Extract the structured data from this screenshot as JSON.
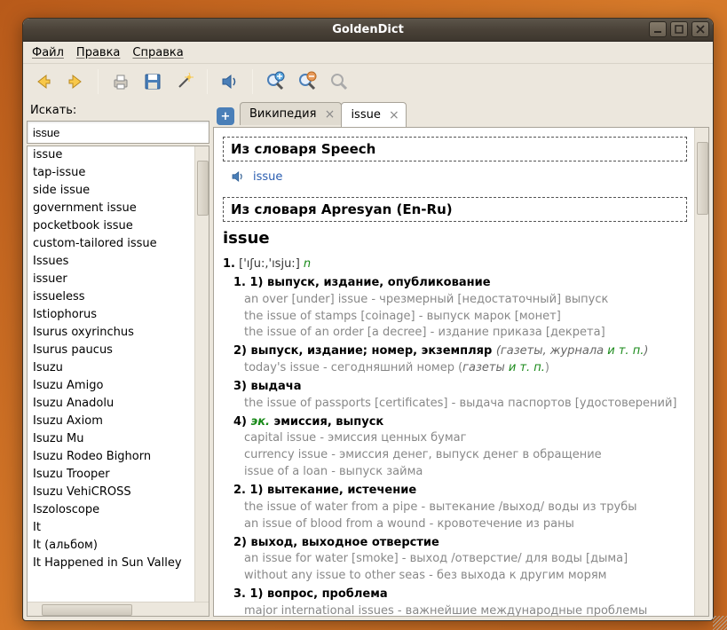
{
  "title": "GoldenDict",
  "menus": {
    "file": "Файл",
    "edit": "Правка",
    "help": "Справка"
  },
  "toolbar": {
    "back": "back-icon",
    "fwd": "fwd-icon",
    "print": "print-icon",
    "save": "save-icon",
    "wand": "wand-icon",
    "sound": "sound-icon",
    "zoomin": "zoom-in-icon",
    "zoomout": "zoom-out-icon",
    "zoomreset": "zoom-reset-icon"
  },
  "sidebar": {
    "search_label": "Искать:",
    "search_value": "issue",
    "words": [
      "issue",
      "tap-issue",
      "side issue",
      "government issue",
      "pocketbook issue",
      "custom-tailored issue",
      "Issues",
      "issuer",
      "issueless",
      "Istiophorus",
      "Isurus oxyrinchus",
      "Isurus paucus",
      "Isuzu",
      "Isuzu Amigo",
      "Isuzu Anadolu",
      "Isuzu Axiom",
      "Isuzu Mu",
      "Isuzu Rodeo Bighorn",
      "Isuzu Trooper",
      "Isuzu VehiCROSS",
      "Iszoloscope",
      "It",
      "It (альбом)",
      "It Happened in Sun Valley"
    ]
  },
  "tabs": [
    {
      "label": "Википедия",
      "active": false
    },
    {
      "label": "issue",
      "active": true
    }
  ],
  "article": {
    "dict1_header": "Из словаря Speech",
    "speech_word": "issue",
    "dict2_header": "Из словаря Apresyan (En-Ru)",
    "headword": "issue",
    "num": "1.",
    "pron": "['ıʃu:,'ısju:]",
    "pos": "n",
    "senses": [
      {
        "label": "1. 1) выпуск, издание, опубликование",
        "examples": [
          "an over [under] issue - чрезмерный [недостаточный] выпуск",
          "the issue of stamps [coinage] - выпуск марок [монет]",
          "the issue of an order [a decree] - издание приказа [декрета]"
        ]
      },
      {
        "label": "2) выпуск, издание; номер, экземпляр",
        "tail_it": "(газеты, журнала ",
        "tail_green": "и т. п.",
        "tail_close": ")",
        "examples": [
          "today's issue - сегодняшний номер (<i>газеты </i><g>и т. п.</g>)"
        ]
      },
      {
        "label": "3) выдача",
        "examples": [
          "the issue of passports [certificates] - выдача паспортов [удостоверений]"
        ]
      },
      {
        "label_pre": "4) ",
        "ec": "эк.",
        "label_post": " эмиссия, выпуск",
        "examples": [
          "capital issue - эмиссия ценных бумаг",
          "currency issue - эмиссия денег, выпуск денег в обращение",
          "issue of a loan - выпуск займа"
        ]
      },
      {
        "label": "2. 1) вытекание, истечение",
        "examples": [
          "the issue of water from a pipe - вытекание /выход/ воды из трубы",
          "an issue of blood from a wound - кровотечение из раны"
        ]
      },
      {
        "label": "2) выход, выходное отверстие",
        "examples": [
          "an issue for water [smoke] - выход /отверстие/ для воды [дыма]",
          "without any issue to other seas - без выхода к другим морям"
        ]
      },
      {
        "label": "3. 1) вопрос, проблема",
        "examples": [
          "major international issues - важнейшие международные проблемы"
        ]
      }
    ]
  }
}
